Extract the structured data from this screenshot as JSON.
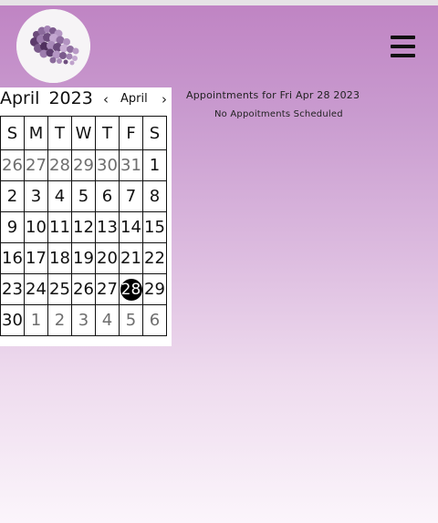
{
  "calendar": {
    "month": "April",
    "year": "2023",
    "nav_prev": "‹",
    "nav_next": "›",
    "month_select": "April",
    "weekdays": [
      "S",
      "M",
      "T",
      "W",
      "T",
      "F",
      "S"
    ],
    "weeks": [
      [
        {
          "d": "26",
          "muted": true
        },
        {
          "d": "27",
          "muted": true
        },
        {
          "d": "28",
          "muted": true
        },
        {
          "d": "29",
          "muted": true
        },
        {
          "d": "30",
          "muted": true
        },
        {
          "d": "31",
          "muted": true
        },
        {
          "d": "1"
        }
      ],
      [
        {
          "d": "2"
        },
        {
          "d": "3"
        },
        {
          "d": "4"
        },
        {
          "d": "5"
        },
        {
          "d": "6"
        },
        {
          "d": "7"
        },
        {
          "d": "8"
        }
      ],
      [
        {
          "d": "9"
        },
        {
          "d": "10"
        },
        {
          "d": "11"
        },
        {
          "d": "12"
        },
        {
          "d": "13"
        },
        {
          "d": "14"
        },
        {
          "d": "15"
        }
      ],
      [
        {
          "d": "16"
        },
        {
          "d": "17"
        },
        {
          "d": "18"
        },
        {
          "d": "19"
        },
        {
          "d": "20"
        },
        {
          "d": "21"
        },
        {
          "d": "22"
        }
      ],
      [
        {
          "d": "23"
        },
        {
          "d": "24"
        },
        {
          "d": "25"
        },
        {
          "d": "26"
        },
        {
          "d": "27"
        },
        {
          "d": "28",
          "today": true
        },
        {
          "d": "29"
        }
      ],
      [
        {
          "d": "30"
        },
        {
          "d": "1",
          "muted": true
        },
        {
          "d": "2",
          "muted": true
        },
        {
          "d": "3",
          "muted": true
        },
        {
          "d": "4",
          "muted": true
        },
        {
          "d": "5",
          "muted": true
        },
        {
          "d": "6",
          "muted": true
        }
      ]
    ]
  },
  "appointments": {
    "title": "Appointments for Fri Apr 28 2023",
    "empty_message": "No Appoitments Scheduled"
  },
  "header": {
    "logo_icon": "lilac-flower-logo",
    "menu_icon": "hamburger-menu-icon"
  },
  "colors": {
    "background_top": "#bf83c3",
    "background_bottom": "#fbf5fb",
    "today_highlight": "#000000"
  }
}
